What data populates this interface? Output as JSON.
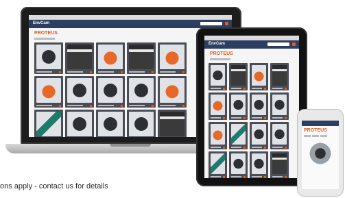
{
  "site": {
    "brand": "PROTEUS",
    "logo_text": "EnvCam"
  },
  "footer": {
    "note": "ons apply - contact us for details"
  },
  "colors": {
    "accent": "#e35a1c",
    "header": "#2d3e63",
    "tile": "#4a4d55"
  },
  "icons": {
    "search": "search-icon",
    "cart": "cart-icon",
    "user": "user-icon"
  }
}
